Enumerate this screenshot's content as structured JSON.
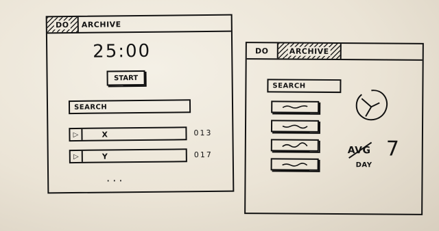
{
  "timer_screen": {
    "tabs": [
      {
        "label": "DO",
        "active": true
      },
      {
        "label": "ARCHIVE",
        "active": false
      }
    ],
    "timer": "25:00",
    "start_label": "START",
    "search_label": "SEARCH",
    "tasks": [
      {
        "play_icon": "play-icon",
        "name": "X",
        "count": "013"
      },
      {
        "play_icon": "play-icon",
        "name": "Y",
        "count": "017"
      }
    ],
    "more": "..."
  },
  "archive_screen": {
    "tabs": [
      {
        "label": "DO",
        "active": false
      },
      {
        "label": "ARCHIVE",
        "active": true
      }
    ],
    "search_label": "SEARCH",
    "items_count_visible": 4,
    "avg_label": "AVG",
    "avg_value": "7",
    "avg_unit": "DAY"
  },
  "colors": {
    "ink": "#141414",
    "paper": "#efe9dd"
  }
}
